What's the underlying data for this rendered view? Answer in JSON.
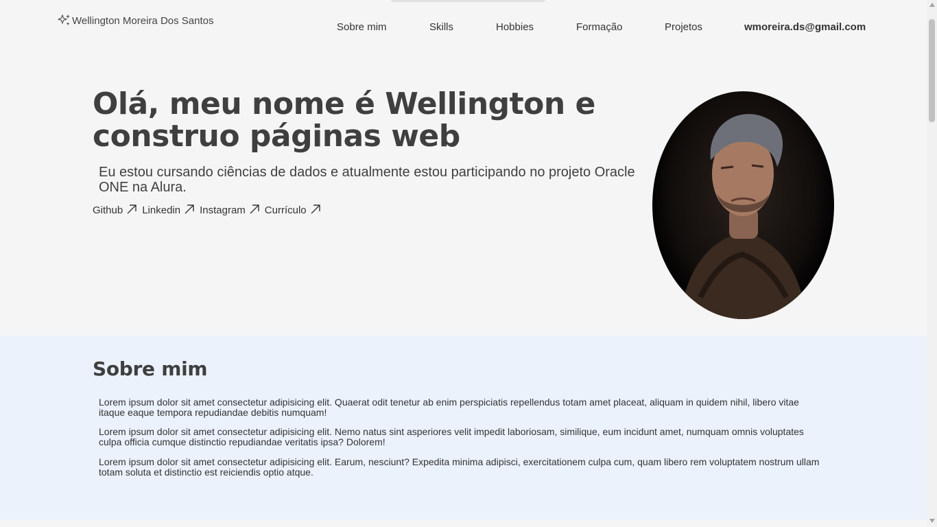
{
  "header": {
    "brand": "Wellington Moreira Dos Santos",
    "nav": [
      "Sobre mim",
      "Skills",
      "Hobbies",
      "Formação",
      "Projetos"
    ],
    "email": "wmoreira.ds@gmail.com"
  },
  "hero": {
    "title": "Olá, meu nome é Wellington e construo páginas web",
    "subtitle": "Eu estou cursando ciências de dados e atualmente estou participando no projeto Oracle ONE na Alura.",
    "links": [
      "Github",
      "Linkedin",
      "Instagram",
      "Currículo"
    ]
  },
  "about": {
    "heading": "Sobre mim",
    "paragraphs": [
      "Lorem ipsum dolor sit amet consectetur adipisicing elit. Quaerat odit tenetur ab enim perspiciatis repellendus totam amet placeat, aliquam in quidem nihil, libero vitae itaque eaque tempora repudiandae debitis numquam!",
      "Lorem ipsum dolor sit amet consectetur adipisicing elit. Nemo natus sint asperiores velit impedit laboriosam, similique, eum incidunt amet, numquam omnis voluptates culpa officia cumque distinctio repudiandae veritatis ipsa? Dolorem!",
      "Lorem ipsum dolor sit amet consectetur adipisicing elit. Earum, nesciunt? Expedita minima adipisci, exercitationem culpa cum, quam libero rem voluptatem nostrum ullam totam soluta et distinctio est reiciendis optio atque."
    ]
  },
  "icons": {
    "brand": "sparkles-icon",
    "link": "arrow-up-right-icon"
  },
  "colors": {
    "background": "#f5f5f5",
    "about_background": "#ebf2fc",
    "text": "#3f3f3f"
  }
}
